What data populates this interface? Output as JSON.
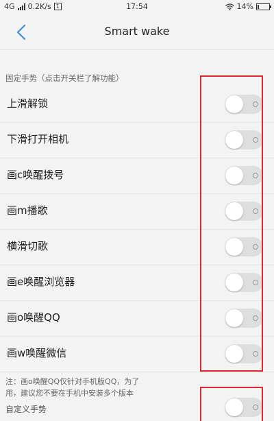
{
  "status_bar": {
    "network": "4G",
    "speed": "0.2K/s",
    "sim": "1",
    "time": "17:54",
    "battery_text": "14%",
    "battery_level": 0.14
  },
  "header": {
    "title": "Smart wake"
  },
  "section_header": "固定手势（点击开关栏了解功能）",
  "gestures": [
    {
      "label": "上滑解锁",
      "enabled": false
    },
    {
      "label": "下滑打开相机",
      "enabled": false
    },
    {
      "label": "画c唤醒拨号",
      "enabled": false
    },
    {
      "label": "画m播歌",
      "enabled": false
    },
    {
      "label": "横滑切歌",
      "enabled": false
    },
    {
      "label": "画e唤醒浏览器",
      "enabled": false
    },
    {
      "label": "画o唤醒QQ",
      "enabled": false
    },
    {
      "label": "画w唤醒微信",
      "enabled": false
    }
  ],
  "note": {
    "line1": "注：画o唤醒QQ仅针对手机版QQ，为了",
    "line2": "用，建议您不要在手机中安装多个版本"
  },
  "custom_gesture": {
    "label": "自定义手势",
    "enabled": false
  },
  "colors": {
    "highlight": "#e0262e",
    "toggle_off": "#dedede",
    "background": "#f3f3f3"
  }
}
